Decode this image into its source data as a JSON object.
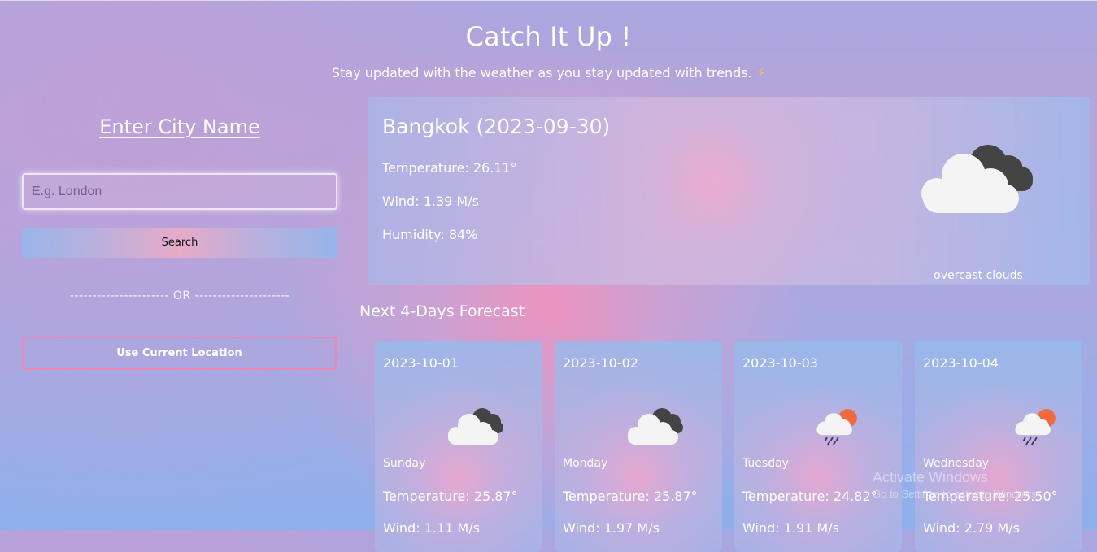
{
  "header": {
    "title": "Catch It Up !",
    "subtitle": "Stay updated with the weather as you stay updated with trends.",
    "subtitle_icon": "⚡"
  },
  "search_panel": {
    "heading": "Enter City Name",
    "input_placeholder": "E.g. London",
    "input_value": "",
    "search_label": "Search",
    "or_divider": "---------------------- OR ---------------------",
    "location_label": "Use Current Location"
  },
  "current": {
    "city_date": "Bangkok (2023-09-30)",
    "temperature": "Temperature: 26.11°",
    "wind": "Wind: 1.39 M/s",
    "humidity": "Humidity: 84%",
    "icon": "overcast-clouds-icon",
    "description": "overcast clouds"
  },
  "forecast": {
    "title": "Next 4-Days Forecast",
    "days": [
      {
        "date": "2023-10-01",
        "day": "Sunday",
        "temperature": "Temperature: 25.87°",
        "wind": "Wind: 1.11 M/s",
        "icon": "overcast-clouds-icon"
      },
      {
        "date": "2023-10-02",
        "day": "Monday",
        "temperature": "Temperature: 25.87°",
        "wind": "Wind: 1.97 M/s",
        "icon": "overcast-clouds-icon"
      },
      {
        "date": "2023-10-03",
        "day": "Tuesday",
        "temperature": "Temperature: 24.82°",
        "wind": "Wind: 1.91 M/s",
        "icon": "sun-rain-cloud-icon"
      },
      {
        "date": "2023-10-04",
        "day": "Wednesday",
        "temperature": "Temperature: 25.50°",
        "wind": "Wind: 2.79 M/s",
        "icon": "sun-rain-cloud-icon"
      }
    ]
  },
  "overlay": {
    "watermark_title": "Activate Windows",
    "watermark_sub": "Go to Settings to activate Windows."
  }
}
